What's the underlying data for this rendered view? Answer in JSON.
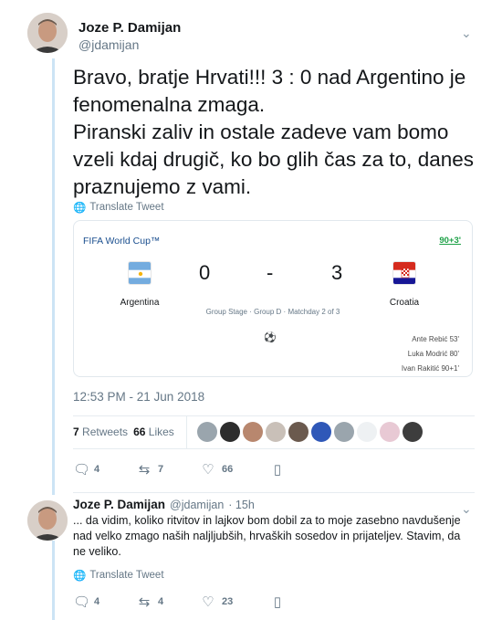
{
  "tweet": {
    "author_name": "Joze P. Damijan",
    "author_handle": "@jdamijan",
    "text": "Bravo, bratje Hrvati!!! 3 : 0 nad Argentino je fenomenalna zmaga.\nPiranski zaliv in ostale zadeve vam bomo vzeli kdaj drugič, ko bo glih čas za to, danes praznujemo z vami.",
    "translate_label": "Translate Tweet",
    "timestamp": "12:53 PM - 21 Jun 2018",
    "retweets_count": "7",
    "retweets_label": "Retweets",
    "likes_count": "66",
    "likes_label": "Likes",
    "actions": {
      "replies": "4",
      "retweets": "7",
      "likes": "66"
    }
  },
  "match_card": {
    "title": "FIFA World Cup™",
    "status": "90+3'",
    "home_team": "Argentina",
    "home_score": "0",
    "separator": "-",
    "away_team": "Croatia",
    "away_score": "3",
    "stage": "Group Stage · Group D · Matchday 2 of 3",
    "scorers": [
      "Ante Rebić 53'",
      "Luka Modrić 80'",
      "Ivan Rakitić 90+1'"
    ]
  },
  "reply": {
    "author_name": "Joze P. Damijan",
    "author_handle": "@jdamijan",
    "time_ago": "· 15h",
    "text": "... da vidim, koliko ritvitov in lajkov bom dobil za to moje zasebno navdušenje nad velko zmago naših naljljubših, hrvaških sosedov in prijateljev. Stavim, da ne veliko.",
    "translate_label": "Translate Tweet",
    "actions": {
      "replies": "4",
      "retweets": "4",
      "likes": "23"
    }
  },
  "icons": {
    "reply": "reply-icon",
    "retweet": "retweet-icon",
    "like": "heart-icon",
    "analytics": "analytics-icon",
    "globe": "globe-icon",
    "chevron": "chevron-down-icon"
  },
  "colors": {
    "thread_line": "#cce4f5",
    "card_title": "#1b4f8f",
    "status_green": "#1da147",
    "secondary_text": "#657786"
  }
}
